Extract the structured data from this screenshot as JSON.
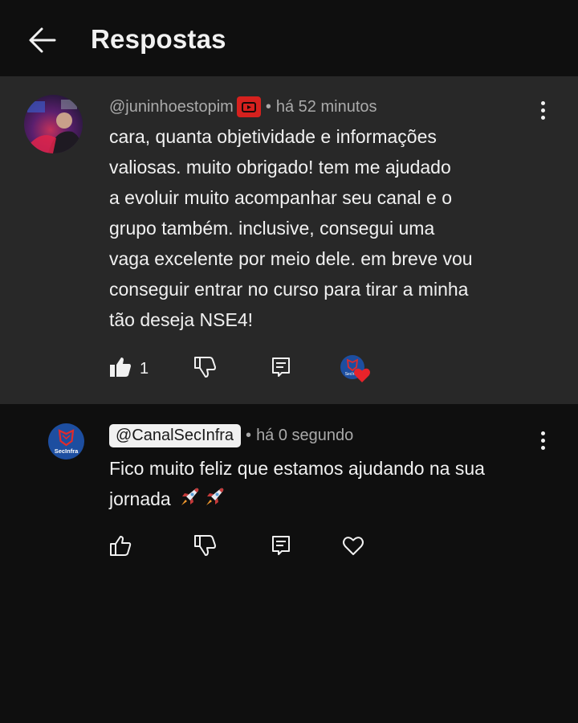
{
  "header": {
    "title": "Respostas"
  },
  "parent_comment": {
    "handle": "@juninhoestopim",
    "separator": "•",
    "time": "há 52 minutos",
    "lines": [
      "cara, quanta objetividade e informações",
      "valiosas. muito obrigado! tem me ajudado",
      "a evoluir muito acompanhar seu canal e o",
      "grupo também. inclusive, consegui uma",
      "vaga excelente por meio dele. em breve vou",
      "conseguir entrar no curso para tirar a minha",
      "tão deseja NSE4!"
    ],
    "like_count": "1",
    "icons": {
      "like": "thumbs-up-filled-icon",
      "dislike": "thumbs-down-icon",
      "reply": "comment-icon",
      "creator_heart": "creator-heart-badge"
    },
    "colors": {
      "background": "#282828",
      "badge": "#d6211e",
      "heart": "#e8232a"
    }
  },
  "reply_comment": {
    "handle": "@CanalSecInfra",
    "separator": "•",
    "time": "há 0 segundo",
    "lines": [
      "Fico muito feliz que estamos ajudando na sua",
      "jornada"
    ],
    "emoji": [
      "🚀",
      "🚀"
    ],
    "avatar_text": "SecInfra",
    "icons": {
      "like": "thumbs-up-outline-icon",
      "dislike": "thumbs-down-icon",
      "reply": "comment-icon",
      "heart": "heart-outline-icon"
    },
    "colors": {
      "background": "#0f0f0f",
      "avatar": "#1d4ea0"
    }
  }
}
